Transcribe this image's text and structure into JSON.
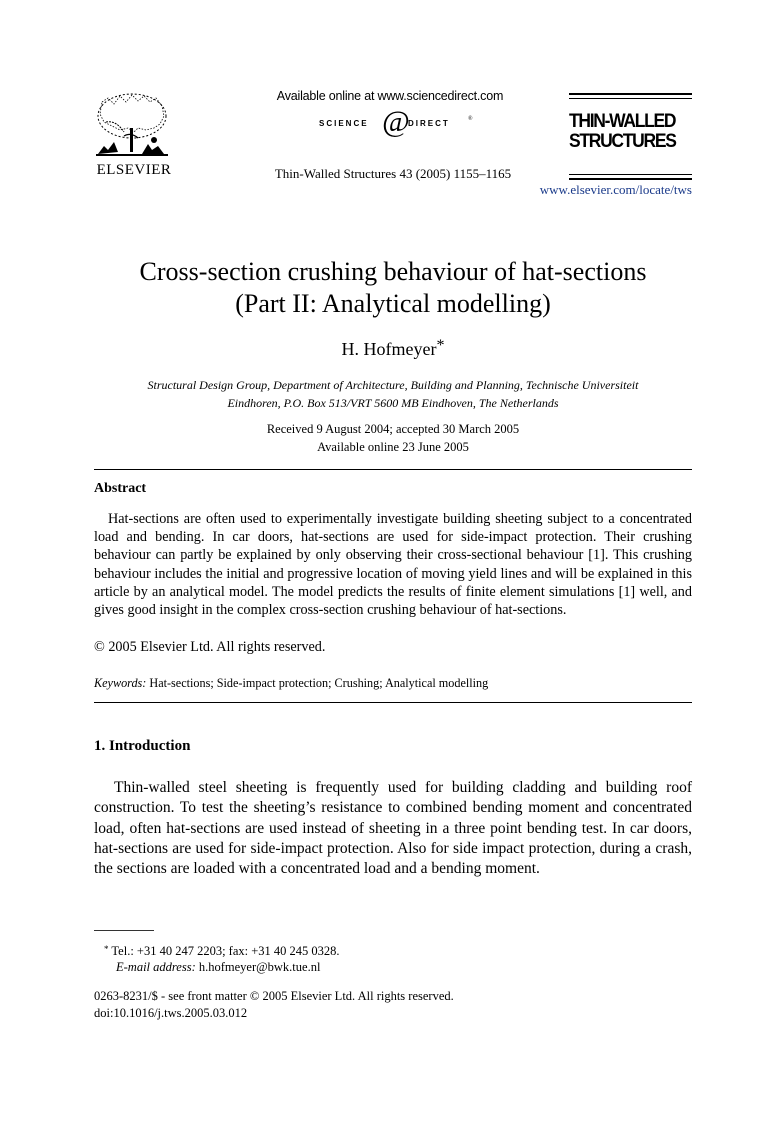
{
  "header": {
    "publisher": "ELSEVIER",
    "available_online": "Available online at www.sciencedirect.com",
    "sciencedirect_logo": {
      "left": "SCIENCE",
      "at": "@",
      "right": "DIRECT",
      "tm": "®"
    },
    "journal_citation": "Thin-Walled Structures 43 (2005) 1155–1165",
    "journal_logo_line1": "THIN-WALLED",
    "journal_logo_line2": "STRUCTURES",
    "journal_url": "www.elsevier.com/locate/tws"
  },
  "article": {
    "title_line1": "Cross-section crushing behaviour of hat-sections",
    "title_line2": "(Part II: Analytical modelling)",
    "author": "H. Hofmeyer",
    "author_marker": "*",
    "affiliation_line1": "Structural Design Group, Department of Architecture, Building and Planning, Technische Universiteit",
    "affiliation_line2": "Eindhoren, P.O. Box 513/VRT 5600 MB Eindhoven, The Netherlands",
    "received": "Received 9 August 2004; accepted 30 March 2005",
    "available": "Available online 23 June 2005"
  },
  "abstract": {
    "heading": "Abstract",
    "text": "Hat-sections are often used to experimentally investigate building sheeting subject to a concentrated load and bending. In car doors, hat-sections are used for side-impact protection. Their crushing behaviour can partly be explained by only observing their cross-sectional behaviour [1]. This crushing behaviour includes the initial and progressive location of moving yield lines and will be explained in this article by an analytical model. The model predicts the results of finite element simulations [1] well, and gives good insight in the complex cross-section crushing behaviour of hat-sections.",
    "copyright": "© 2005 Elsevier Ltd. All rights reserved.",
    "keywords_label": "Keywords:",
    "keywords": "Hat-sections; Side-impact protection; Crushing; Analytical modelling"
  },
  "introduction": {
    "heading": "1. Introduction",
    "text": "Thin-walled steel sheeting is frequently used for building cladding and building roof construction. To test the sheeting’s resistance to combined bending moment and concentrated load, often hat-sections are used instead of sheeting in a three point bending test. In car doors, hat-sections are used for side-impact protection. Also for side impact protection, during a crash, the sections are loaded with a concentrated load and a bending moment."
  },
  "footnotes": {
    "marker": "*",
    "tel_fax": "Tel.: +31 40 247 2203; fax: +31 40 245 0328.",
    "email_label": "E-mail address:",
    "email": "h.hofmeyer@bwk.tue.nl",
    "issn_line": "0263-8231/$ - see front matter © 2005 Elsevier Ltd. All rights reserved.",
    "doi": "doi:10.1016/j.tws.2005.03.012"
  },
  "colors": {
    "link": "#1a3a8a",
    "text": "#000000"
  }
}
